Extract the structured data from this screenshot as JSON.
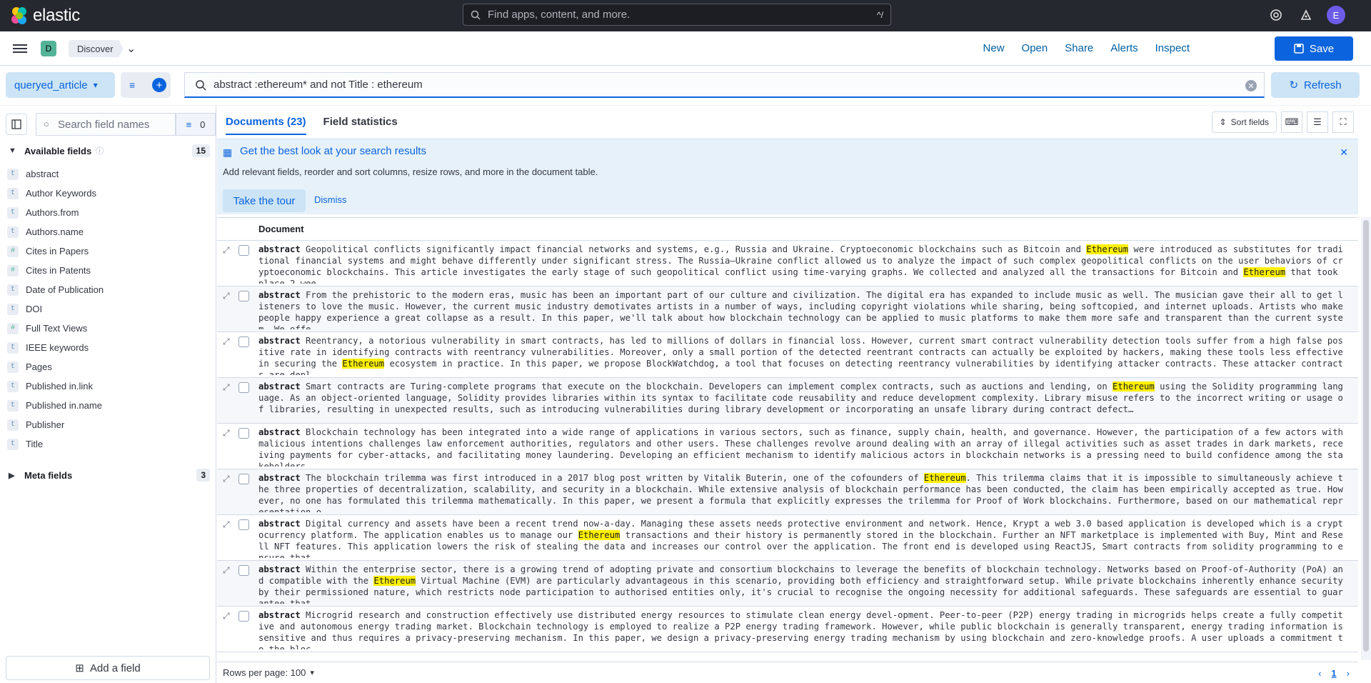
{
  "topbar": {
    "brand": "elastic",
    "search_placeholder": "Find apps, content, and more.",
    "search_shortcut": "^/",
    "avatar_initial": "E"
  },
  "appbar": {
    "space_badge": "D",
    "breadcrumb": "Discover",
    "links": [
      "New",
      "Open",
      "Share",
      "Alerts",
      "Inspect"
    ],
    "save_label": "Save"
  },
  "query": {
    "data_view": "queryed_article",
    "value": "abstract :ethereum* and not Title : ethereum",
    "refresh_label": "Refresh"
  },
  "sidebar": {
    "search_placeholder": "Search field names",
    "filter_count": "0",
    "available_label": "Available fields",
    "available_count": "15",
    "fields": [
      {
        "name": "abstract",
        "type": "t"
      },
      {
        "name": "Author Keywords",
        "type": "t"
      },
      {
        "name": "Authors.from",
        "type": "t"
      },
      {
        "name": "Authors.name",
        "type": "t"
      },
      {
        "name": "Cites in Papers",
        "type": "#"
      },
      {
        "name": "Cites in Patents",
        "type": "#"
      },
      {
        "name": "Date of Publication",
        "type": "t"
      },
      {
        "name": "DOI",
        "type": "t"
      },
      {
        "name": "Full Text Views",
        "type": "#"
      },
      {
        "name": "IEEE keywords",
        "type": "t"
      },
      {
        "name": "Pages",
        "type": "t"
      },
      {
        "name": "Published in.link",
        "type": "t"
      },
      {
        "name": "Published in.name",
        "type": "t"
      },
      {
        "name": "Publisher",
        "type": "t"
      },
      {
        "name": "Title",
        "type": "t"
      }
    ],
    "meta_label": "Meta fields",
    "meta_count": "3",
    "add_field": "Add a field"
  },
  "main": {
    "tab_documents": "Documents (23)",
    "tab_stats": "Field statistics",
    "sort_fields": "Sort fields",
    "callout_title": "Get the best look at your search results",
    "callout_text": "Add relevant fields, reorder and sort columns, resize rows, and more in the document table.",
    "tour_label": "Take the tour",
    "dismiss_label": "Dismiss",
    "column_header": "Document",
    "field_label": "abstract",
    "rows_per_page": "Rows per page: 100",
    "page": "1"
  },
  "rows": [
    "Geopolitical conflicts significantly impact financial networks and systems, e.g., Russia and Ukraine. Cryptoeconomic blockchains such as Bitcoin and [[Ethereum]] were introduced as substitutes for traditional financial systems and might behave differently under significant stress. The Russia–Ukraine conflict allowed us to analyze the impact of such complex geopolitical conflicts on the user behaviors of cryptoeconomic blockchains. This article investigates the early stage of such geopolitical conflict using time-varying graphs. We collected and analyzed all the transactions for Bitcoin and [[Ethereum]] that took place 2 wee…",
    "From the prehistoric to the modern eras, music has been an important part of our culture and civilization. The digital era has expanded to include music as well. The musician gave their all to get listeners to love the music. However, the current music industry demotivates artists in a number of ways, including copyright violations while sharing, being softcopied, and internet uploads. Artists who make people happy experience a great collapse as a result. In this paper, we'll talk about how blockchain technology can be applied to music platforms to make them more safe and transparent than the current system. We offe…",
    "Reentrancy, a notorious vulnerability in smart contracts, has led to millions of dollars in financial loss. However, current smart contract vulnerability detection tools suffer from a high false positive rate in identifying contracts with reentrancy vulnerabilities. Moreover, only a small portion of the detected reentrant contracts can actually be exploited by hackers, making these tools less effective in securing the [[Ethereum]] ecosystem in practice. In this paper, we propose BlockWatchdog, a tool that focuses on detecting reentrancy vulnerabilities by identifying attacker contracts. These attacker contracts are depl…",
    "Smart contracts are Turing-complete programs that execute on the blockchain. Developers can implement complex contracts, such as auctions and lending, on [[Ethereum]] using the Solidity programming language. As an object-oriented language, Solidity provides libraries within its syntax to facilitate code reusability and reduce development complexity. Library misuse refers to the incorrect writing or usage of libraries, resulting in unexpected results, such as introducing vulnerabilities during library development or incorporating an unsafe library during contract defect…",
    "Blockchain technology has been integrated into a wide range of applications in various sectors, such as finance, supply chain, health, and governance. However, the participation of a few actors with malicious intentions challenges law enforcement authorities, regulators and other users. These challenges revolve around dealing with an array of illegal activities such as asset trades in dark markets, receiving payments for cyber-attacks, and facilitating money laundering. Developing an efficient mechanism to identify malicious actors in blockchain networks is a pressing need to build confidence among the stakeholders …",
    "The blockchain trilemma was first introduced in a 2017 blog post written by Vitalik Buterin, one of the cofounders of [[Ethereum]]. This trilemma claims that it is impossible to simultaneously achieve the three properties of decentralization, scalability, and security in a blockchain. While extensive analysis of blockchain performance has been conducted, the claim has been empirically accepted as true. However, no one has formulated this trilemma mathematically. In this paper, we present a formula that explicitly expresses the trilemma for Proof of Work blockchains. Furthermore, based on our mathematical representation o…",
    "Digital currency and assets have been a recent trend now-a-day. Managing these assets needs protective environment and network. Hence, Krypt a web 3.0 based application is developed which is a cryptocurrency platform. The application enables us to manage our [[Ethereum]] transactions and their history is permanently stored in the blockchain. Further an NFT marketplace is implemented with Buy, Mint and Resell NFT features. This application lowers the risk of stealing the data and increases our control over the application. The front end is developed using ReactJS, Smart contracts from solidity programming to ensure that …",
    "Within the enterprise sector, there is a growing trend of adopting private and consortium blockchains to leverage the benefits of blockchain technology. Networks based on Proof-of-Authority (PoA) and compatible with the [[Ethereum]] Virtual Machine (EVM) are particularly advantageous in this scenario, providing both efficiency and straightforward setup. While private blockchains inherently enhance security by their permissioned nature, which restricts node participation to authorised entities only, it's crucial to recognise the ongoing necessity for additional safeguards. These safeguards are essential to guarantee that…",
    "Microgrid research and construction effectively use distributed energy resources to stimulate clean energy devel-opment. Peer-to-peer (P2P) energy trading in microgrids helps create a fully competitive and autonomous energy trading market. Blockchain technology is employed to realize a P2P energy trading framework. However, while public blockchain is generally transparent, energy trading information is sensitive and thus requires a privacy-preserving mechanism. In this paper, we design a privacy-preserving energy trading mechanism by using blockchain and zero-knowledge proofs. A user uploads a commitment to the bloc…"
  ]
}
